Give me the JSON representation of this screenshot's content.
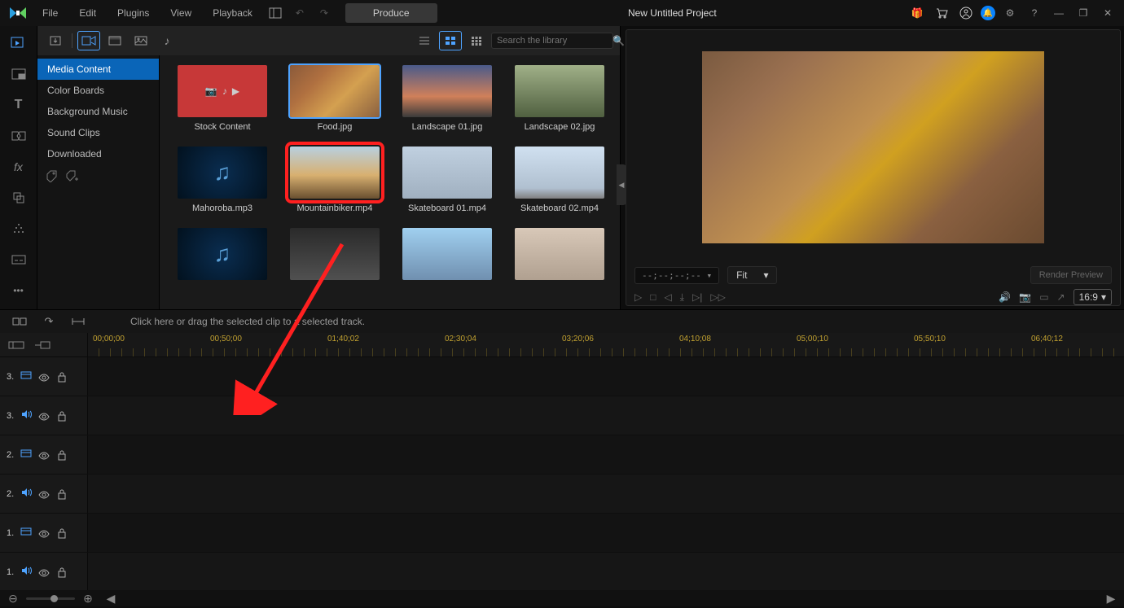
{
  "app": {
    "title": "New Untitled Project"
  },
  "menu": {
    "file": "File",
    "edit": "Edit",
    "plugins": "Plugins",
    "view": "View",
    "playback": "Playback"
  },
  "produce": "Produce",
  "search": {
    "placeholder": "Search the library"
  },
  "categories": {
    "media_content": "Media Content",
    "color_boards": "Color Boards",
    "background_music": "Background Music",
    "sound_clips": "Sound Clips",
    "downloaded": "Downloaded"
  },
  "thumbs": {
    "stock": "Stock Content",
    "food": "Food.jpg",
    "land1": "Landscape 01.jpg",
    "land2": "Landscape 02.jpg",
    "maho": "Mahoroba.mp3",
    "mtn": "Mountainbiker.mp4",
    "sk1": "Skateboard 01.mp4",
    "sk2": "Skateboard 02.mp4"
  },
  "preview": {
    "timecode": "--;--;--;-- ▾",
    "fit": "Fit",
    "render": "Render Preview",
    "aspect": "16:9"
  },
  "timeline": {
    "hint": "Click here or drag the selected clip to a selected track.",
    "marks": [
      "00;00;00",
      "00;50;00",
      "01;40;02",
      "02;30;04",
      "03;20;06",
      "04;10;08",
      "05;00;10",
      "05;50;10",
      "06;40;12"
    ],
    "tracks": [
      {
        "num": "3.",
        "type": "video"
      },
      {
        "num": "3.",
        "type": "audio"
      },
      {
        "num": "2.",
        "type": "video"
      },
      {
        "num": "2.",
        "type": "audio"
      },
      {
        "num": "1.",
        "type": "video"
      },
      {
        "num": "1.",
        "type": "audio"
      }
    ]
  }
}
